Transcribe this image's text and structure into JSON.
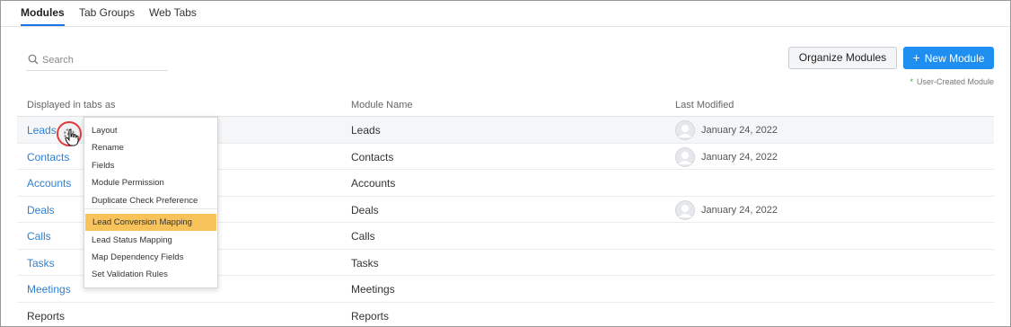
{
  "tabs": [
    {
      "label": "Modules",
      "active": true
    },
    {
      "label": "Tab Groups",
      "active": false
    },
    {
      "label": "Web Tabs",
      "active": false
    }
  ],
  "search": {
    "placeholder": "Search"
  },
  "toolbar": {
    "organize_label": "Organize Modules",
    "new_label": "New Module",
    "legend_star": "*",
    "legend_text": "User-Created Module"
  },
  "table": {
    "headers": [
      "Displayed in tabs as",
      "Module Name",
      "Last Modified"
    ],
    "rows": [
      {
        "tab": "Leads",
        "module": "Leads",
        "modified": "January 24, 2022"
      },
      {
        "tab": "Contacts",
        "module": "Contacts",
        "modified": "January 24, 2022"
      },
      {
        "tab": "Accounts",
        "module": "Accounts",
        "modified": ""
      },
      {
        "tab": "Deals",
        "module": "Deals",
        "modified": "January 24, 2022"
      },
      {
        "tab": "Calls",
        "module": "Calls",
        "modified": ""
      },
      {
        "tab": "Tasks",
        "module": "Tasks",
        "modified": ""
      },
      {
        "tab": "Meetings",
        "module": "Meetings",
        "modified": ""
      },
      {
        "tab": "Reports",
        "module": "Reports",
        "modified": ""
      }
    ]
  },
  "menu": {
    "items": [
      "Layout",
      "Rename",
      "Fields",
      "Module Permission",
      "Duplicate Check Preference",
      "Lead Conversion Mapping",
      "Lead Status Mapping",
      "Map Dependency Fields",
      "Set Validation Rules"
    ],
    "highlighted": "Lead Conversion Mapping"
  },
  "colors": {
    "accent": "#1f8ef1",
    "link": "#2f7fd1",
    "highlight": "#f8c35a",
    "legend_star": "#2eae4d",
    "cursor_ring": "#e03a3a"
  },
  "icons": {
    "search": "search-icon",
    "gear": "gear-icon",
    "pointer": "hand-pointer-icon",
    "avatar": "user-avatar-icon",
    "plus": "plus-icon"
  }
}
